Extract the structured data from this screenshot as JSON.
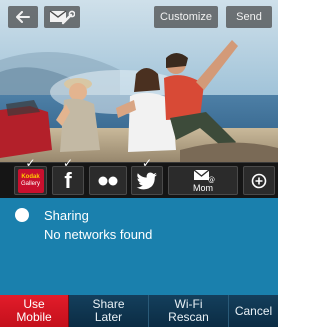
{
  "header": {
    "back_icon": "back-arrow-icon",
    "edit_icon": "envelope-wrench-icon",
    "customize_label": "Customize",
    "send_label": "Send"
  },
  "share_destinations": [
    {
      "id": "kodak",
      "icon": "kodak-gallery-icon",
      "line1": "Kodak",
      "line2": "Gallery",
      "selected": true
    },
    {
      "id": "facebook",
      "icon": "facebook-icon",
      "glyph": "f",
      "selected": true
    },
    {
      "id": "flickr",
      "icon": "flickr-icon",
      "selected": false
    },
    {
      "id": "twitter",
      "icon": "twitter-icon",
      "selected": true
    },
    {
      "id": "email",
      "icon": "email-icon",
      "label": "Mom",
      "selected": false
    },
    {
      "id": "more",
      "icon": "add-circle-icon",
      "selected": false
    }
  ],
  "status": {
    "title": "Sharing",
    "message": "No networks found"
  },
  "actions": {
    "use_mobile": [
      "Use",
      "Mobile"
    ],
    "share_later": [
      "Share",
      "Later"
    ],
    "wifi_rescan": [
      "Wi-Fi",
      "Rescan"
    ],
    "cancel": "Cancel"
  },
  "colors": {
    "status_background": "#1a80ad",
    "primary_action": "#d4151f",
    "action_bar": "#0b2c44",
    "share_strip": "#151515",
    "kodak_red": "#c8102e",
    "kodak_yellow": "#ffcc00"
  }
}
